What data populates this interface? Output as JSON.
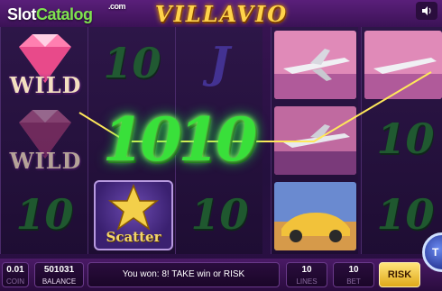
{
  "header": {
    "logo_main": "Slot",
    "logo_accent": "Catalog",
    "logo_com": ".com",
    "title": "VILLAVIO",
    "sound_icon": "speaker-icon"
  },
  "reels": {
    "wild_label": "WILD",
    "ten_label": "10",
    "j_label": "J",
    "scatter_label": "Scatter"
  },
  "win_overlay": "1010",
  "bottom": {
    "coin_value": "0.01",
    "coin_label": "COIN",
    "balance_value": "501031",
    "balance_label": "BALANCE",
    "message": "You won: 8! TAKE win or RISK",
    "lines_value": "10",
    "lines_label": "LINES",
    "bet_value": "10",
    "bet_label": "BET",
    "risk_label": "RISK",
    "spin_label": "T"
  },
  "colors": {
    "win_green": "#39e03a",
    "title_gold": "#ffd34a",
    "risk_gold": "#e0a91a"
  }
}
